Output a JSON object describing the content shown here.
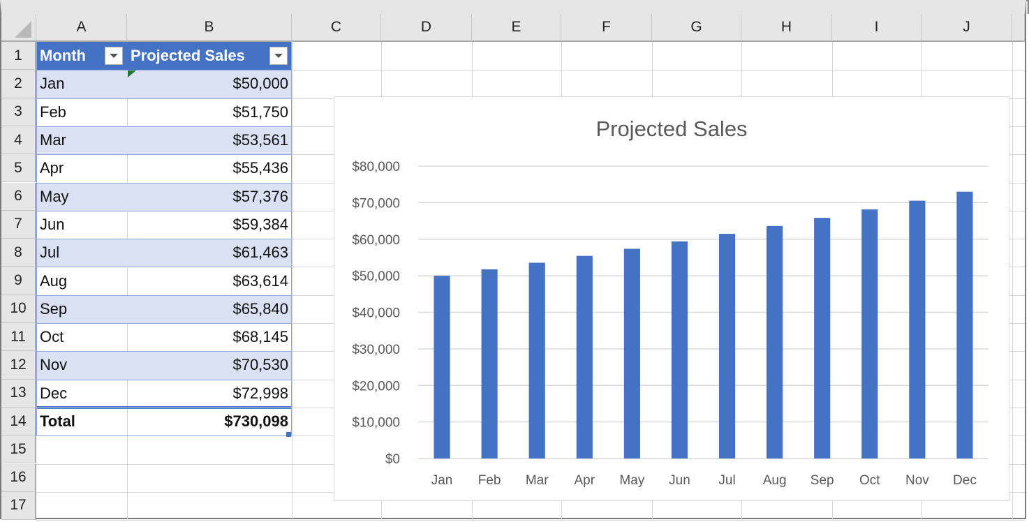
{
  "sheet": {
    "columns": [
      "A",
      "B",
      "C",
      "D",
      "E",
      "F",
      "G",
      "H",
      "I",
      "J"
    ],
    "rows": [
      "1",
      "2",
      "3",
      "4",
      "5",
      "6",
      "7",
      "8",
      "9",
      "10",
      "11",
      "12",
      "13",
      "14",
      "15",
      "16",
      "17"
    ]
  },
  "table": {
    "headers": [
      "Month",
      "Projected Sales"
    ],
    "rows": [
      {
        "month": "Jan",
        "sales": "$50,000"
      },
      {
        "month": "Feb",
        "sales": "$51,750"
      },
      {
        "month": "Mar",
        "sales": "$53,561"
      },
      {
        "month": "Apr",
        "sales": "$55,436"
      },
      {
        "month": "May",
        "sales": "$57,376"
      },
      {
        "month": "Jun",
        "sales": "$59,384"
      },
      {
        "month": "Jul",
        "sales": "$61,463"
      },
      {
        "month": "Aug",
        "sales": "$63,614"
      },
      {
        "month": "Sep",
        "sales": "$65,840"
      },
      {
        "month": "Oct",
        "sales": "$68,145"
      },
      {
        "month": "Nov",
        "sales": "$70,530"
      },
      {
        "month": "Dec",
        "sales": "$72,998"
      }
    ],
    "total": {
      "label": "Total",
      "value": "$730,098"
    },
    "header_color": "#4472c4",
    "band_color": "#d9e1f2"
  },
  "chart_data": {
    "type": "bar",
    "title": "Projected Sales",
    "categories": [
      "Jan",
      "Feb",
      "Mar",
      "Apr",
      "May",
      "Jun",
      "Jul",
      "Aug",
      "Sep",
      "Oct",
      "Nov",
      "Dec"
    ],
    "values": [
      50000,
      51750,
      53561,
      55436,
      57376,
      59384,
      61463,
      63614,
      65840,
      68145,
      70530,
      72998
    ],
    "series": [
      {
        "name": "Projected Sales",
        "values": [
          50000,
          51750,
          53561,
          55436,
          57376,
          59384,
          61463,
          63614,
          65840,
          68145,
          70530,
          72998
        ]
      }
    ],
    "xlabel": "",
    "ylabel": "",
    "ylim": [
      0,
      80000
    ],
    "yticks": [
      0,
      10000,
      20000,
      30000,
      40000,
      50000,
      60000,
      70000,
      80000
    ],
    "ytick_labels": [
      "$0",
      "$10,000",
      "$20,000",
      "$30,000",
      "$40,000",
      "$50,000",
      "$60,000",
      "$70,000",
      "$80,000"
    ],
    "grid": true,
    "legend": "none",
    "bar_color": "#4472c4"
  }
}
